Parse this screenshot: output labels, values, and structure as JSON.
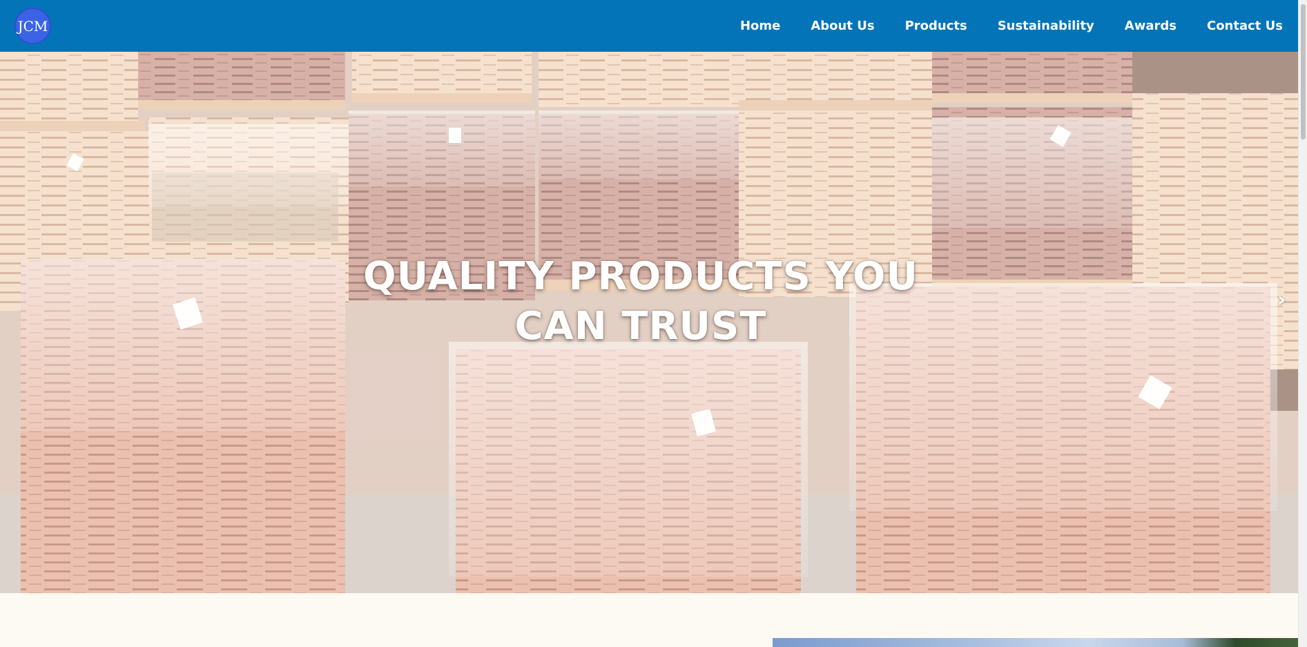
{
  "header": {
    "logo_text": "JCM",
    "brand_color": "#0474b8",
    "logo_color": "#3b63e6"
  },
  "nav": {
    "items": [
      "Home",
      "About Us",
      "Products",
      "Sustainability",
      "Awards",
      "Contact Us"
    ]
  },
  "hero": {
    "title": "QUALITY PRODUCTS YOU CAN TRUST",
    "next_glyph": "›",
    "background_icon": "stacked-wood-veneer-pallets-image"
  },
  "content": {
    "image_icon": "landscape-image"
  }
}
